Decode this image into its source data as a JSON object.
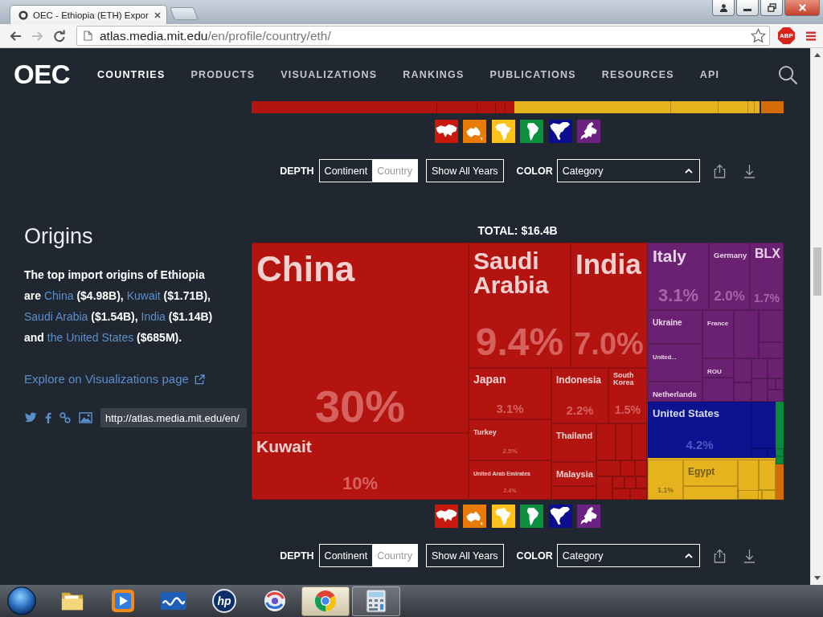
{
  "browser": {
    "tab_title": "OEC - Ethiopia (ETH) Expor",
    "url_host": "atlas.media.mit.edu",
    "url_path": "/en/profile/country/eth/",
    "extension_badge": "ABP"
  },
  "nav": {
    "logo": "OEC",
    "items": [
      {
        "label": "COUNTRIES",
        "selected": true
      },
      {
        "label": "PRODUCTS",
        "selected": false
      },
      {
        "label": "VISUALIZATIONS",
        "selected": false
      },
      {
        "label": "RANKINGS",
        "selected": false
      },
      {
        "label": "PUBLICATIONS",
        "selected": false
      },
      {
        "label": "RESOURCES",
        "selected": false
      },
      {
        "label": "API",
        "selected": false
      }
    ]
  },
  "export_section": {
    "treemap_strip": [
      {
        "color": "#b31410"
      },
      {
        "color": "#e6b31e"
      },
      {
        "color": "#d46c05"
      }
    ],
    "legend": [
      {
        "kind": "asia",
        "color": "#c9190d"
      },
      {
        "kind": "oceania",
        "color": "#e87b06"
      },
      {
        "kind": "africa",
        "color": "#fcc21a"
      },
      {
        "kind": "south_america",
        "color": "#0a8f3c"
      },
      {
        "kind": "north_america",
        "color": "#0b0f8f"
      },
      {
        "kind": "europe",
        "color": "#6c2280"
      }
    ],
    "controls": {
      "depth_label": "DEPTH",
      "depth_options": [
        {
          "label": "Continent",
          "selected": false
        },
        {
          "label": "Country",
          "selected": true
        }
      ],
      "years_button": "Show All Years",
      "color_label": "COLOR",
      "color_select": "Category"
    }
  },
  "origins": {
    "heading": "Origins",
    "description": [
      {
        "kind": "text",
        "text": "The top import origins of Ethiopia are "
      },
      {
        "kind": "link",
        "text": "China"
      },
      {
        "kind": "text",
        "text": " ($4.98B), "
      },
      {
        "kind": "link",
        "text": "Kuwait"
      },
      {
        "kind": "text",
        "text": " ($1.71B), "
      },
      {
        "kind": "link",
        "text": "Saudi Arabia"
      },
      {
        "kind": "text",
        "text": " ($1.54B), "
      },
      {
        "kind": "link",
        "text": "India"
      },
      {
        "kind": "text",
        "text": " ($1.14B) and "
      },
      {
        "kind": "link",
        "text": "the United States"
      },
      {
        "kind": "text",
        "text": " ($685M)."
      }
    ],
    "explore_link": "Explore on Visualizations page",
    "share_url": "http://atlas.media.mit.edu/en/",
    "total": "TOTAL: $16.4B",
    "treemap": {
      "groups": [
        {
          "color": "#b31410",
          "tiles": [
            {
              "label": "China",
              "share": "30%"
            },
            {
              "label": "Kuwait",
              "share": "10%"
            },
            {
              "label": "Saudi Arabia",
              "share": "9.4%"
            },
            {
              "label": "India",
              "share": "7.0%"
            },
            {
              "label": "Japan",
              "share": "3.1%"
            },
            {
              "label": "Turkey",
              "share": "2.5%"
            },
            {
              "label": "United Arab Emirates",
              "share": "2.4%"
            },
            {
              "label": "Indonesia",
              "share": "2.2%"
            },
            {
              "label": "South Korea",
              "share": "1.5%"
            },
            {
              "label": "Thailand"
            },
            {
              "label": "Malaysia"
            }
          ]
        },
        {
          "color": "#6b2171",
          "tiles": [
            {
              "label": "Italy",
              "share": "3.1%"
            },
            {
              "label": "Germany",
              "share": "2.0%"
            },
            {
              "label": "BLX",
              "share": "1.7%"
            },
            {
              "label": "Ukraine"
            },
            {
              "label": "United..."
            },
            {
              "label": "Netherlands"
            },
            {
              "label": "France"
            },
            {
              "label": "ROU"
            }
          ]
        },
        {
          "color": "#0c1390",
          "tiles": [
            {
              "label": "United States",
              "share": "4.2%"
            }
          ]
        },
        {
          "color": "#0a8a3c"
        },
        {
          "color": "#e6b31e",
          "tiles": [
            {
              "share": "1.1%"
            },
            {
              "label": "Egypt"
            }
          ]
        },
        {
          "color": "#d46c05"
        }
      ]
    },
    "legend": [
      {
        "kind": "asia",
        "color": "#c9190d"
      },
      {
        "kind": "oceania",
        "color": "#e87b06"
      },
      {
        "kind": "africa",
        "color": "#fcc21a"
      },
      {
        "kind": "south_america",
        "color": "#0a8f3c"
      },
      {
        "kind": "north_america",
        "color": "#0b0f8f"
      },
      {
        "kind": "europe",
        "color": "#6c2280"
      }
    ],
    "controls": {
      "depth_label": "DEPTH",
      "depth_options": [
        {
          "label": "Continent",
          "selected": false
        },
        {
          "label": "Country",
          "selected": true
        }
      ],
      "years_button": "Show All Years",
      "color_label": "COLOR",
      "color_select": "Category"
    }
  },
  "taskbar": {
    "apps": [
      {
        "kind": "folder",
        "open": false,
        "selected": false
      },
      {
        "kind": "media",
        "open": false,
        "selected": false
      },
      {
        "kind": "wave",
        "open": false,
        "selected": false
      },
      {
        "kind": "hp",
        "label": "hp",
        "open": false,
        "selected": false
      },
      {
        "kind": "swirl",
        "open": false,
        "selected": false
      },
      {
        "kind": "browser",
        "open": true,
        "selected": true
      },
      {
        "kind": "calculator",
        "open": true,
        "selected": false
      }
    ]
  }
}
